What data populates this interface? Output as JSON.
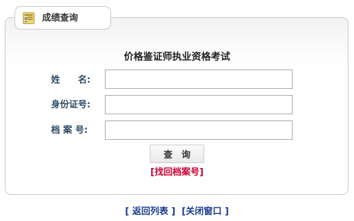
{
  "tab": {
    "icon": "certificate-icon",
    "label": "成绩查询"
  },
  "form": {
    "title": "价格鉴证师执业资格考试",
    "fields": [
      {
        "label": "姓　　名:",
        "value": "",
        "placeholder": ""
      },
      {
        "label": "身份证号:",
        "value": "",
        "placeholder": ""
      },
      {
        "label": "档 案 号:",
        "value": "",
        "placeholder": ""
      }
    ],
    "query_button": "查　询",
    "retrieve_link": "[找回档案号]"
  },
  "footer": {
    "back_link": "[ 返回列表 ]",
    "close_link": "[关闭窗口 ]"
  },
  "colors": {
    "label_text": "#2c4a66",
    "retrieve_link": "#cc0033",
    "footer_links": "#1a3c8c",
    "border": "#c8c8c8"
  }
}
